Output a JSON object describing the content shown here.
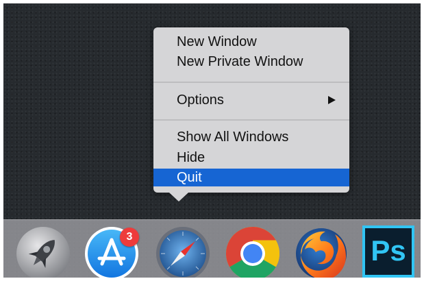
{
  "context_menu": {
    "items": [
      {
        "label": "New Window"
      },
      {
        "label": "New Private Window"
      },
      {
        "label": "Options",
        "has_submenu": true
      },
      {
        "label": "Show All Windows"
      },
      {
        "label": "Hide"
      },
      {
        "label": "Quit",
        "selected": true
      }
    ],
    "highlight_color": "#1665d3"
  },
  "dock": {
    "apps": [
      {
        "name": "launchpad",
        "icon": "rocket-icon"
      },
      {
        "name": "app-store",
        "icon": "app-store-icon",
        "badge": "3"
      },
      {
        "name": "safari",
        "icon": "compass-icon"
      },
      {
        "name": "chrome",
        "icon": "chrome-icon"
      },
      {
        "name": "firefox",
        "icon": "firefox-icon"
      },
      {
        "name": "photoshop",
        "icon": "photoshop-icon",
        "label": "Ps"
      }
    ]
  },
  "colors": {
    "desktop": "#262a2e",
    "menu_background": "#d5d5d7",
    "badge": "#ee3b3b",
    "photoshop_accent": "#31c5f4"
  }
}
